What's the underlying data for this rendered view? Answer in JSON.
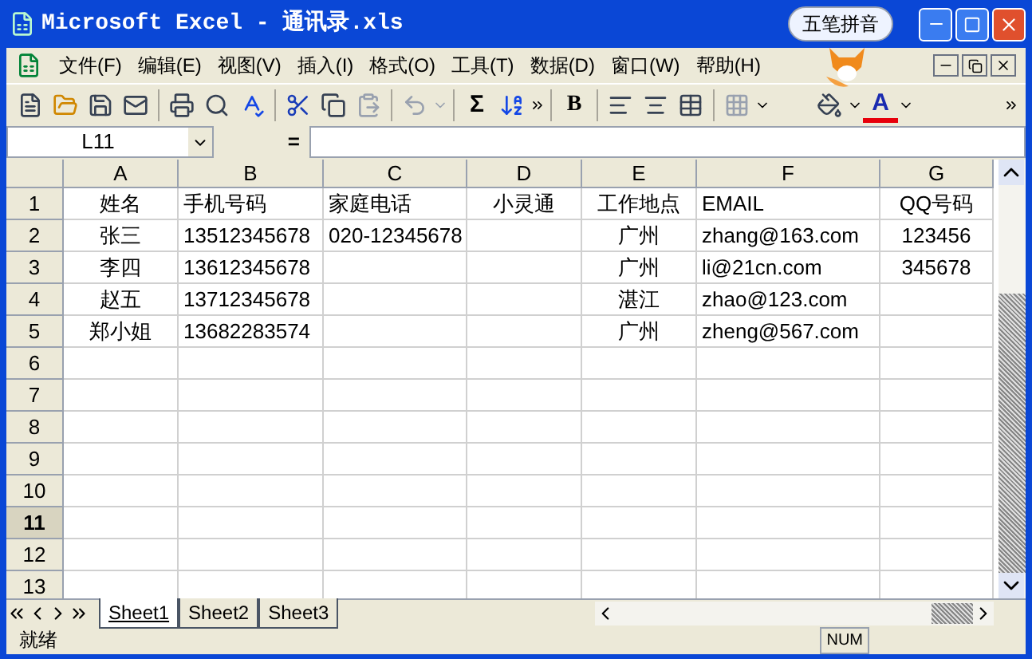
{
  "window": {
    "title": "Microsoft Excel - 通讯录.xls"
  },
  "ime_badge": "五笔拼音",
  "menu": [
    "文件(F)",
    "编辑(E)",
    "视图(V)",
    "插入(I)",
    "格式(O)",
    "工具(T)",
    "数据(D)",
    "窗口(W)",
    "帮助(H)"
  ],
  "toolbar": {
    "glyphs": [
      "Σ",
      "B",
      "A"
    ]
  },
  "name_box": "L11",
  "formula_sign": "=",
  "columns": [
    "A",
    "B",
    "C",
    "D",
    "E",
    "F",
    "G"
  ],
  "rows": [
    {
      "number": "1",
      "selected": false,
      "cells": {
        "A": "姓名",
        "B": "手机号码",
        "C": "家庭电话",
        "D": "小灵通",
        "E": "工作地点",
        "F": "EMAIL",
        "G": "QQ号码"
      }
    },
    {
      "number": "2",
      "selected": false,
      "cells": {
        "A": "张三",
        "B": "13512345678",
        "C": "020-12345678",
        "E": "广州",
        "F": "zhang@163.com",
        "G": "123456"
      }
    },
    {
      "number": "3",
      "selected": false,
      "cells": {
        "A": "李四",
        "B": "13612345678",
        "E": "广州",
        "F": "li@21cn.com",
        "G": "345678"
      }
    },
    {
      "number": "4",
      "selected": false,
      "cells": {
        "A": "赵五",
        "B": "13712345678",
        "E": "湛江",
        "F": "zhao@123.com"
      }
    },
    {
      "number": "5",
      "selected": false,
      "cells": {
        "A": "郑小姐",
        "B": "13682283574",
        "E": "广州",
        "F": "zheng@567.com"
      }
    },
    {
      "number": "6",
      "selected": false,
      "cells": {}
    },
    {
      "number": "7",
      "selected": false,
      "cells": {}
    },
    {
      "number": "8",
      "selected": false,
      "cells": {}
    },
    {
      "number": "9",
      "selected": false,
      "cells": {}
    },
    {
      "number": "10",
      "selected": false,
      "cells": {}
    },
    {
      "number": "11",
      "selected": true,
      "cells": {}
    },
    {
      "number": "12",
      "selected": false,
      "cells": {}
    },
    {
      "number": "13",
      "selected": false,
      "cells": {}
    }
  ],
  "sheet_tabs": [
    {
      "label": "Sheet1",
      "selected": true
    },
    {
      "label": "Sheet2",
      "selected": false
    },
    {
      "label": "Sheet3",
      "selected": false
    }
  ],
  "status_bar": {
    "text": "就绪",
    "indicators": [
      "NUM"
    ]
  }
}
